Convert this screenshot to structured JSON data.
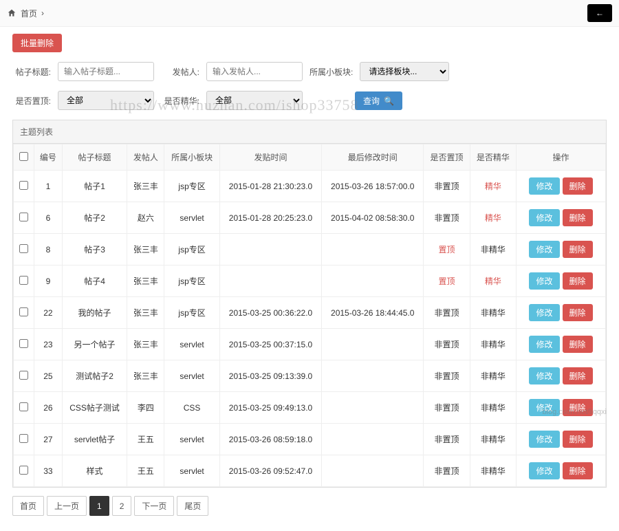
{
  "breadcrumb": {
    "home_label": "首页",
    "sep": "›"
  },
  "back_button": "←",
  "batch_delete_label": "批量删除",
  "filters": {
    "title_label": "帖子标题:",
    "title_placeholder": "输入帖子标题...",
    "poster_label": "发帖人:",
    "poster_placeholder": "输入发帖人...",
    "board_label": "所属小板块:",
    "board_placeholder": "请选择板块...",
    "top_label": "是否置顶:",
    "top_value": "全部",
    "elite_label": "是否精华:",
    "elite_value": "全部",
    "search_label": "查询"
  },
  "panel_title": "主题列表",
  "columns": {
    "id": "编号",
    "title": "帖子标题",
    "poster": "发帖人",
    "board": "所属小板块",
    "post_time": "发贴时间",
    "last_mod": "最后修改时间",
    "is_top": "是否置顶",
    "is_elite": "是否精华",
    "ops": "操作"
  },
  "ops": {
    "edit": "修改",
    "del": "删除"
  },
  "rows": [
    {
      "id": "1",
      "title": "帖子1",
      "poster": "张三丰",
      "board": "jsp专区",
      "post_time": "2015-01-28 21:30:23.0",
      "last_mod": "2015-03-26 18:57:00.0",
      "top": "非置顶",
      "top_red": false,
      "elite": "精华",
      "elite_red": true
    },
    {
      "id": "6",
      "title": "帖子2",
      "poster": "赵六",
      "board": "servlet",
      "post_time": "2015-01-28 20:25:23.0",
      "last_mod": "2015-04-02 08:58:30.0",
      "top": "非置顶",
      "top_red": false,
      "elite": "精华",
      "elite_red": true
    },
    {
      "id": "8",
      "title": "帖子3",
      "poster": "张三丰",
      "board": "jsp专区",
      "post_time": "",
      "last_mod": "",
      "top": "置顶",
      "top_red": true,
      "elite": "非精华",
      "elite_red": false
    },
    {
      "id": "9",
      "title": "帖子4",
      "poster": "张三丰",
      "board": "jsp专区",
      "post_time": "",
      "last_mod": "",
      "top": "置顶",
      "top_red": true,
      "elite": "精华",
      "elite_red": true
    },
    {
      "id": "22",
      "title": "我的帖子",
      "poster": "张三丰",
      "board": "jsp专区",
      "post_time": "2015-03-25 00:36:22.0",
      "last_mod": "2015-03-26 18:44:45.0",
      "top": "非置顶",
      "top_red": false,
      "elite": "非精华",
      "elite_red": false
    },
    {
      "id": "23",
      "title": "另一个帖子",
      "poster": "张三丰",
      "board": "servlet",
      "post_time": "2015-03-25 00:37:15.0",
      "last_mod": "",
      "top": "非置顶",
      "top_red": false,
      "elite": "非精华",
      "elite_red": false
    },
    {
      "id": "25",
      "title": "测试帖子2",
      "poster": "张三丰",
      "board": "servlet",
      "post_time": "2015-03-25 09:13:39.0",
      "last_mod": "",
      "top": "非置顶",
      "top_red": false,
      "elite": "非精华",
      "elite_red": false
    },
    {
      "id": "26",
      "title": "CSS帖子测试",
      "poster": "李四",
      "board": "CSS",
      "post_time": "2015-03-25 09:49:13.0",
      "last_mod": "",
      "top": "非置顶",
      "top_red": false,
      "elite": "非精华",
      "elite_red": false
    },
    {
      "id": "27",
      "title": "servlet帖子",
      "poster": "王五",
      "board": "servlet",
      "post_time": "2015-03-26 08:59:18.0",
      "last_mod": "",
      "top": "非置顶",
      "top_red": false,
      "elite": "非精华",
      "elite_red": false
    },
    {
      "id": "33",
      "title": "样式",
      "poster": "王五",
      "board": "servlet",
      "post_time": "2015-03-26 09:52:47.0",
      "last_mod": "",
      "top": "非置顶",
      "top_red": false,
      "elite": "非精华",
      "elite_red": false
    }
  ],
  "pagination": {
    "first": "首页",
    "prev": "上一页",
    "page1": "1",
    "page2": "2",
    "next": "下一页",
    "last": "尾页"
  },
  "watermark_url": "https://www.huzhan.com/ishop33758",
  "watermark_csdn": "blog.csdn.net/liqqxi"
}
